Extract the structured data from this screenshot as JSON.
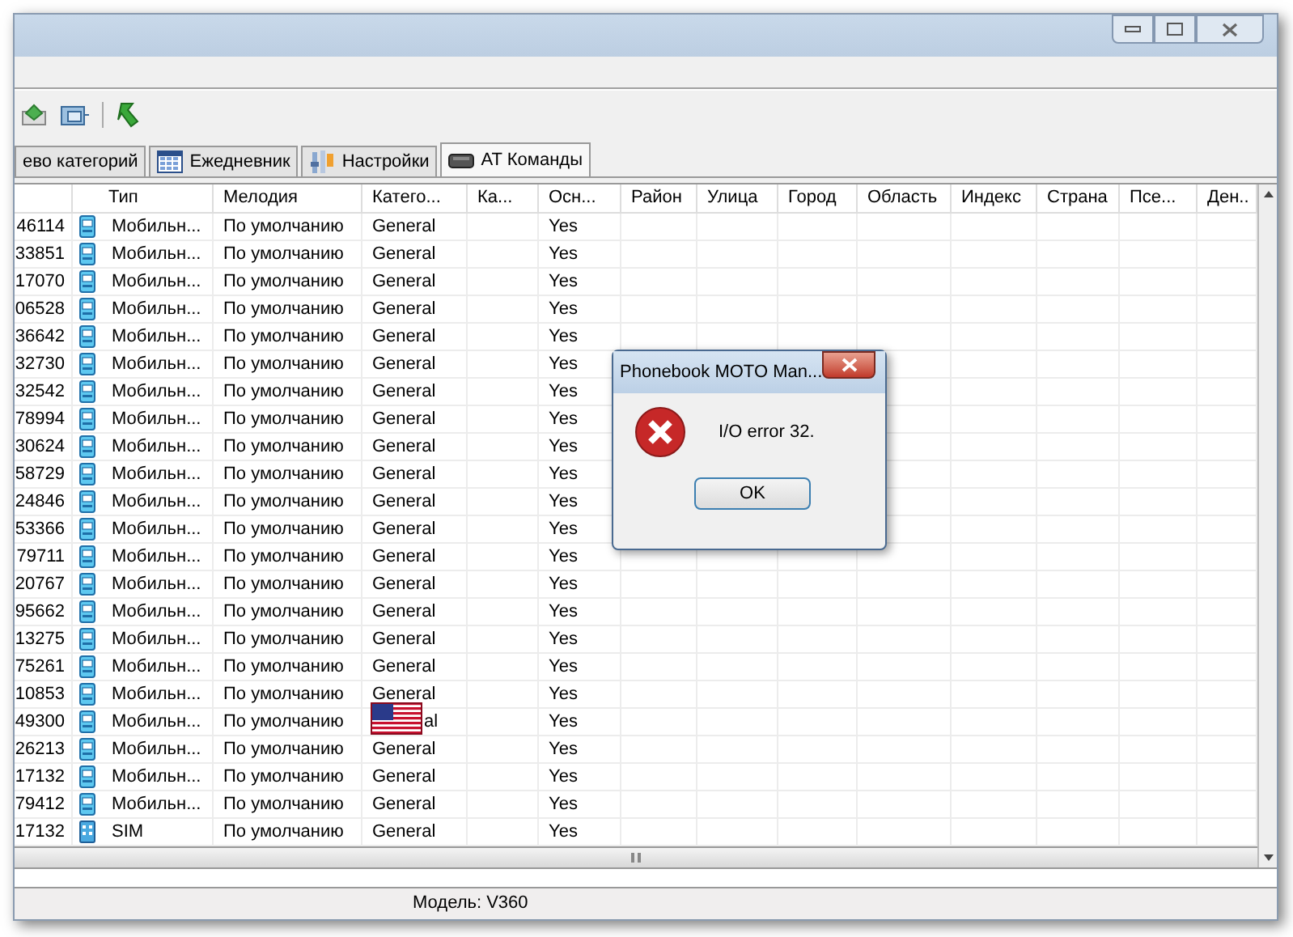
{
  "tabs": [
    {
      "label": "ево категорий",
      "kind": "tree",
      "selected": false
    },
    {
      "label": "Ежедневник",
      "kind": "calendar",
      "selected": false
    },
    {
      "label": "Настройки",
      "kind": "settings",
      "selected": false
    },
    {
      "label": "AT Команды",
      "kind": "modem",
      "selected": true
    }
  ],
  "table": {
    "columns": [
      "Тип",
      "Мелодия",
      "Катего...",
      "Ка...",
      "Осн...",
      "Район",
      "Улица",
      "Город",
      "Область",
      "Индекс",
      "Страна",
      "Псе...",
      "Ден.."
    ],
    "rows": [
      {
        "column_1": "46114",
        "kind": "mobile",
        "type": "Мобильн...",
        "melody": "По умолчанию",
        "category": "General",
        "main": "Yes"
      },
      {
        "column_1": "33851",
        "kind": "mobile",
        "type": "Мобильн...",
        "melody": "По умолчанию",
        "category": "General",
        "main": "Yes"
      },
      {
        "column_1": "17070",
        "kind": "mobile",
        "type": "Мобильн...",
        "melody": "По умолчанию",
        "category": "General",
        "main": "Yes"
      },
      {
        "column_1": "06528",
        "kind": "mobile",
        "type": "Мобильн...",
        "melody": "По умолчанию",
        "category": "General",
        "main": "Yes"
      },
      {
        "column_1": "36642",
        "kind": "mobile",
        "type": "Мобильн...",
        "melody": "По умолчанию",
        "category": "General",
        "main": "Yes"
      },
      {
        "column_1": "32730",
        "kind": "mobile",
        "type": "Мобильн...",
        "melody": "По умолчанию",
        "category": "General",
        "main": "Yes"
      },
      {
        "column_1": "32542",
        "kind": "mobile",
        "type": "Мобильн...",
        "melody": "По умолчанию",
        "category": "General",
        "main": "Yes"
      },
      {
        "column_1": "78994",
        "kind": "mobile",
        "type": "Мобильн...",
        "melody": "По умолчанию",
        "category": "General",
        "main": "Yes"
      },
      {
        "column_1": "30624",
        "kind": "mobile",
        "type": "Мобильн...",
        "melody": "По умолчанию",
        "category": "General",
        "main": "Yes"
      },
      {
        "column_1": "58729",
        "kind": "mobile",
        "type": "Мобильн...",
        "melody": "По умолчанию",
        "category": "General",
        "main": "Yes"
      },
      {
        "column_1": "24846",
        "kind": "mobile",
        "type": "Мобильн...",
        "melody": "По умолчанию",
        "category": "General",
        "main": "Yes"
      },
      {
        "column_1": "53366",
        "kind": "mobile",
        "type": "Мобильн...",
        "melody": "По умолчанию",
        "category": "General",
        "main": "Yes"
      },
      {
        "column_1": "79711",
        "kind": "mobile",
        "type": "Мобильн...",
        "melody": "По умолчанию",
        "category": "General",
        "main": "Yes"
      },
      {
        "column_1": "20767",
        "kind": "mobile",
        "type": "Мобильн...",
        "melody": "По умолчанию",
        "category": "General",
        "main": "Yes"
      },
      {
        "column_1": "95662",
        "kind": "mobile",
        "type": "Мобильн...",
        "melody": "По умолчанию",
        "category": "General",
        "main": "Yes"
      },
      {
        "column_1": "13275",
        "kind": "mobile",
        "type": "Мобильн...",
        "melody": "По умолчанию",
        "category": "General",
        "main": "Yes"
      },
      {
        "column_1": "75261",
        "kind": "mobile",
        "type": "Мобильн...",
        "melody": "По умолчанию",
        "category": "General",
        "main": "Yes"
      },
      {
        "column_1": "10853",
        "kind": "mobile",
        "type": "Мобильн...",
        "melody": "По умолчанию",
        "category": "General",
        "main": "Yes"
      },
      {
        "column_1": "49300",
        "kind": "mobile",
        "type": "Мобильн...",
        "melody": "По умолчанию",
        "category": "al",
        "category_covered": true,
        "main": "Yes"
      },
      {
        "column_1": "26213",
        "kind": "mobile",
        "type": "Мобильн...",
        "melody": "По умолчанию",
        "category": "General",
        "main": "Yes"
      },
      {
        "column_1": "17132",
        "kind": "mobile",
        "type": "Мобильн...",
        "melody": "По умолчанию",
        "category": "General",
        "main": "Yes"
      },
      {
        "column_1": "79412",
        "kind": "mobile",
        "type": "Мобильн...",
        "melody": "По умолчанию",
        "category": "General",
        "main": "Yes"
      },
      {
        "column_1": "17132",
        "kind": "sim",
        "type": "SIM",
        "melody": "По умолчанию",
        "category": "General",
        "main": "Yes"
      }
    ]
  },
  "dialog": {
    "title": "Phonebook MOTO Man...",
    "message": "I/O error 32.",
    "button": "OK"
  },
  "status_bar": {
    "model": "Модель: V360"
  }
}
